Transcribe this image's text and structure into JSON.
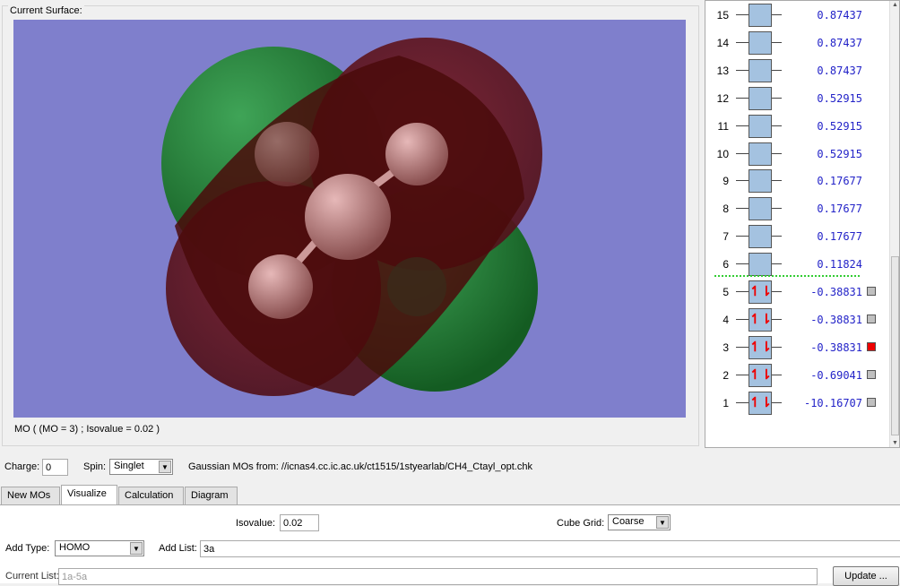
{
  "surface_group": {
    "title": "Current Surface:",
    "caption": "MO ( (MO = 3) ; Isovalue = 0.02 )"
  },
  "colors": {
    "background": "#7f7fcc",
    "positive_lobe": "#8b1a1a",
    "negative_lobe": "#1f7a2e",
    "energy_text": "#2323c8",
    "selected": "#ee0000"
  },
  "mo_levels": [
    {
      "n": "15",
      "energy": "0.87437",
      "occupied": false
    },
    {
      "n": "14",
      "energy": "0.87437",
      "occupied": false
    },
    {
      "n": "13",
      "energy": "0.87437",
      "occupied": false
    },
    {
      "n": "12",
      "energy": "0.52915",
      "occupied": false
    },
    {
      "n": "11",
      "energy": "0.52915",
      "occupied": false
    },
    {
      "n": "10",
      "energy": "0.52915",
      "occupied": false
    },
    {
      "n": "9",
      "energy": "0.17677",
      "occupied": false
    },
    {
      "n": "8",
      "energy": "0.17677",
      "occupied": false
    },
    {
      "n": "7",
      "energy": "0.17677",
      "occupied": false
    },
    {
      "n": "6",
      "energy": "0.11824",
      "occupied": false
    },
    {
      "n": "5",
      "energy": "-0.38831",
      "occupied": true,
      "selected": false
    },
    {
      "n": "4",
      "energy": "-0.38831",
      "occupied": true,
      "selected": false
    },
    {
      "n": "3",
      "energy": "-0.38831",
      "occupied": true,
      "selected": true
    },
    {
      "n": "2",
      "energy": "-0.69041",
      "occupied": true,
      "selected": false
    },
    {
      "n": "1",
      "energy": "-10.16707",
      "occupied": true,
      "selected": false
    }
  ],
  "controls": {
    "charge_label": "Charge:",
    "charge_value": "0",
    "spin_label": "Spin:",
    "spin_value": "Singlet",
    "source_text": "Gaussian MOs from:  //icnas4.cc.ic.ac.uk/ct1515/1styearlab/CH4_Ctayl_opt.chk"
  },
  "tabs": [
    {
      "label": "New MOs"
    },
    {
      "label": "Visualize"
    },
    {
      "label": "Calculation"
    },
    {
      "label": "Diagram"
    }
  ],
  "visualize": {
    "isovalue_label": "Isovalue:",
    "isovalue": "0.02",
    "cube_grid_label": "Cube Grid:",
    "cube_grid": "Coarse",
    "add_type_label": "Add Type:",
    "add_type": "HOMO",
    "add_list_label": "Add List:",
    "add_list": "3a",
    "current_list_label": "Current List:",
    "current_list": "1a-5a",
    "update_label": "Update ..."
  }
}
